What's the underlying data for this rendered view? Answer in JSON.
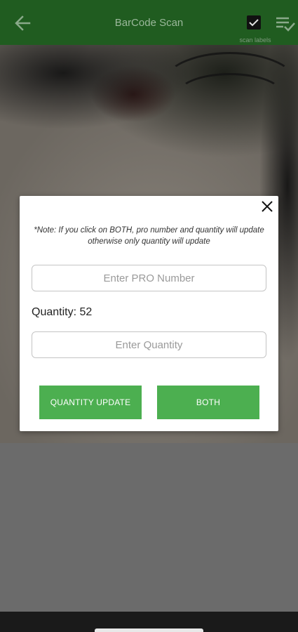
{
  "appbar": {
    "title": "BarCode Scan",
    "back_icon": "arrow-left-icon",
    "scan_labels_checkbox": {
      "label": "scan labels",
      "checked": true
    },
    "list_check_icon": "playlist-check-icon",
    "bg_color": "#205c20"
  },
  "dialog": {
    "note": "*Note: If you click on BOTH, pro number and quantity will update otherwise only quantity will update",
    "pro_input": {
      "placeholder": "Enter PRO Number",
      "value": ""
    },
    "quantity_label": "Quantity: 52",
    "quantity_input": {
      "placeholder": "Enter Quantity",
      "value": ""
    },
    "buttons": {
      "quantity_update": "QUANTITY UPDATE",
      "both": "BOTH"
    },
    "close_icon": "close-icon",
    "button_color": "#4caf50"
  }
}
